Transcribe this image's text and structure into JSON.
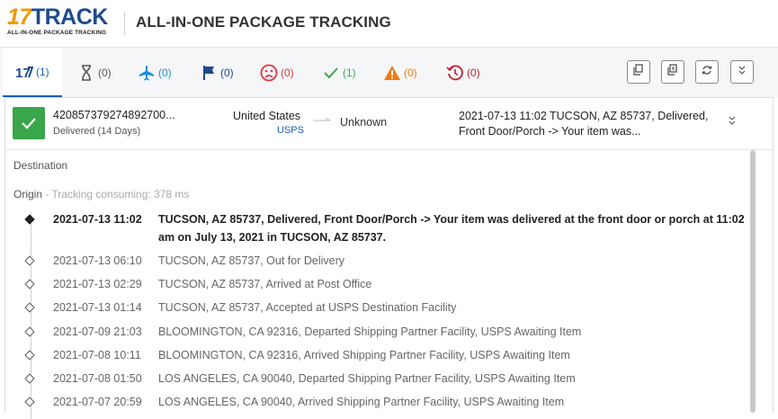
{
  "header": {
    "logo_num": "17",
    "logo_word": "TRACK",
    "logo_tagline": "ALL-IN-ONE PACKAGE TRACKING",
    "title": "ALL-IN-ONE PACKAGE TRACKING"
  },
  "tabs": [
    {
      "icon": "17-logo-icon",
      "count": "(1)",
      "color": "#1b5fb4"
    },
    {
      "icon": "hourglass-icon",
      "count": "(0)",
      "color": "#555555"
    },
    {
      "icon": "airplane-icon",
      "count": "(0)",
      "color": "#1a8fd8"
    },
    {
      "icon": "flag-icon",
      "count": "(0)",
      "color": "#1e4a8c"
    },
    {
      "icon": "sad-face-icon",
      "count": "(0)",
      "color": "#e0323a"
    },
    {
      "icon": "checkmark-icon",
      "count": "(1)",
      "color": "#3aa64a"
    },
    {
      "icon": "warning-icon",
      "count": "(0)",
      "color": "#f07a16"
    },
    {
      "icon": "history-icon",
      "count": "(0)",
      "color": "#c2202e"
    }
  ],
  "actions": [
    "copy-icon",
    "copy-all-icon",
    "refresh-icon",
    "collapse-all-icon"
  ],
  "package": {
    "tracking_number": "420857379274892700...",
    "status": "Delivered (14 Days)",
    "origin_country": "United States",
    "carrier": "USPS",
    "destination_country": "Unknown",
    "latest_event": "2021-07-13 11:02  TUCSON, AZ 85737, Delivered, Front Door/Porch -> Your item was...",
    "status_color": "#3aa64a"
  },
  "details": {
    "destination_label": "Destination",
    "origin_label": "Origin",
    "consuming": "- Tracking consuming: 378 ms"
  },
  "events": [
    {
      "time": "2021-07-13 11:02",
      "desc": "TUCSON, AZ 85737, Delivered, Front Door/Porch -> Your item was delivered at the front door or porch at 11:02 am on July 13, 2021 in TUCSON, AZ 85737."
    },
    {
      "time": "2021-07-13 06:10",
      "desc": "TUCSON, AZ 85737, Out for Delivery"
    },
    {
      "time": "2021-07-13 02:29",
      "desc": "TUCSON, AZ 85737, Arrived at Post Office"
    },
    {
      "time": "2021-07-13 01:14",
      "desc": "TUCSON, AZ 85737, Accepted at USPS Destination Facility"
    },
    {
      "time": "2021-07-09 21:03",
      "desc": "BLOOMINGTON, CA 92316, Departed Shipping Partner Facility, USPS Awaiting Item"
    },
    {
      "time": "2021-07-08 10:11",
      "desc": "BLOOMINGTON, CA 92316, Arrived Shipping Partner Facility, USPS Awaiting Item"
    },
    {
      "time": "2021-07-08 01:50",
      "desc": "LOS ANGELES, CA 90040, Departed Shipping Partner Facility, USPS Awaiting Item"
    },
    {
      "time": "2021-07-07 20:59",
      "desc": "LOS ANGELES, CA 90040, Arrived Shipping Partner Facility, USPS Awaiting Item"
    }
  ]
}
